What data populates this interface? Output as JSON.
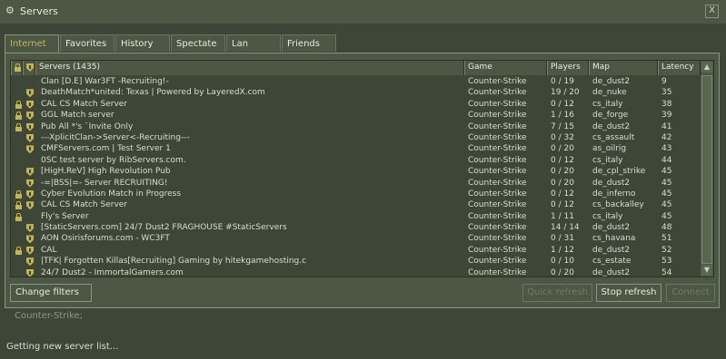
{
  "window": {
    "title": "Servers",
    "close": "X"
  },
  "tabs": [
    {
      "label": "Internet",
      "active": true
    },
    {
      "label": "Favorites"
    },
    {
      "label": "History"
    },
    {
      "label": "Spectate"
    },
    {
      "label": "Lan"
    },
    {
      "label": "Friends"
    }
  ],
  "columns": {
    "servers": "Servers (1435)",
    "game": "Game",
    "players": "Players",
    "map": "Map",
    "latency": "Latency"
  },
  "servers": [
    {
      "lock": false,
      "vac": false,
      "name": "Clan [D.E] War3FT -Recruiting!-",
      "game": "Counter-Strike",
      "players": "0 / 19",
      "map": "de_dust2",
      "latency": "9"
    },
    {
      "lock": false,
      "vac": true,
      "name": "DeathMatch*united: Texas | Powered by LayeredX.com",
      "game": "Counter-Strike",
      "players": "19 / 20",
      "map": "de_nuke",
      "latency": "35"
    },
    {
      "lock": true,
      "vac": true,
      "name": "CAL CS Match Server",
      "game": "Counter-Strike",
      "players": "0 / 12",
      "map": "cs_italy",
      "latency": "38"
    },
    {
      "lock": true,
      "vac": true,
      "name": "GGL Match server",
      "game": "Counter-Strike",
      "players": "1 / 16",
      "map": "de_forge",
      "latency": "39"
    },
    {
      "lock": true,
      "vac": true,
      "name": "Pub All *'s `Invite Only",
      "game": "Counter-Strike",
      "players": "7 / 15",
      "map": "de_dust2",
      "latency": "41"
    },
    {
      "lock": false,
      "vac": true,
      "name": "---XplicitClan->Server<-Recruiting---",
      "game": "Counter-Strike",
      "players": "0 / 32",
      "map": "cs_assault",
      "latency": "42"
    },
    {
      "lock": false,
      "vac": true,
      "name": "CMFServers.com | Test Server 1",
      "game": "Counter-Strike",
      "players": "0 / 20",
      "map": "as_oilrig",
      "latency": "43"
    },
    {
      "lock": false,
      "vac": false,
      "name": "0SC test server by RibServers.com.",
      "game": "Counter-Strike",
      "players": "0 / 12",
      "map": "cs_italy",
      "latency": "44"
    },
    {
      "lock": false,
      "vac": true,
      "name": "[HigH.ReV] High Revolution Pub",
      "game": "Counter-Strike",
      "players": "0 / 20",
      "map": "de_cpl_strike",
      "latency": "45"
    },
    {
      "lock": false,
      "vac": true,
      "name": "-=|BSS|=- Server RECRUITING!",
      "game": "Counter-Strike",
      "players": "0 / 20",
      "map": "de_dust2",
      "latency": "45"
    },
    {
      "lock": true,
      "vac": true,
      "name": "Cyber Evolution Match in Progress",
      "game": "Counter-Strike",
      "players": "0 / 12",
      "map": "de_inferno",
      "latency": "45"
    },
    {
      "lock": true,
      "vac": true,
      "name": "CAL CS Match Server",
      "game": "Counter-Strike",
      "players": "0 / 12",
      "map": "cs_backalley",
      "latency": "45"
    },
    {
      "lock": true,
      "vac": false,
      "name": "Fly's Server",
      "game": "Counter-Strike",
      "players": "1 / 11",
      "map": "cs_italy",
      "latency": "45"
    },
    {
      "lock": false,
      "vac": true,
      "name": "[StaticServers.com] 24/7 Dust2 FRAGHOUSE #StaticServers",
      "game": "Counter-Strike",
      "players": "14 / 14",
      "map": "de_dust2",
      "latency": "48"
    },
    {
      "lock": false,
      "vac": true,
      "name": "AON Osirisforums.com - WC3FT",
      "game": "Counter-Strike",
      "players": "0 / 31",
      "map": "cs_havana",
      "latency": "51"
    },
    {
      "lock": true,
      "vac": true,
      "name": "CAL",
      "game": "Counter-Strike",
      "players": "1 / 12",
      "map": "de_dust2",
      "latency": "52"
    },
    {
      "lock": false,
      "vac": true,
      "name": "|TFK| Forgotten Killas[Recruiting] Gaming by hitekgamehosting.c",
      "game": "Counter-Strike",
      "players": "0 / 10",
      "map": "cs_estate",
      "latency": "53"
    },
    {
      "lock": false,
      "vac": true,
      "name": "24/7 Dust2 - ImmortalGamers.com",
      "game": "Counter-Strike",
      "players": "0 / 20",
      "map": "de_dust2",
      "latency": "54"
    }
  ],
  "buttons": {
    "change_filters": "Change filters",
    "quick_refresh": "Quick refresh",
    "stop_refresh": "Stop refresh",
    "connect": "Connect"
  },
  "filter_text": "Counter-Strike;",
  "status": "Getting new server list...",
  "colors": {
    "background": "#3e4637",
    "panel": "#4c5844",
    "accent": "#c4b550",
    "text": "#d8ded3"
  }
}
